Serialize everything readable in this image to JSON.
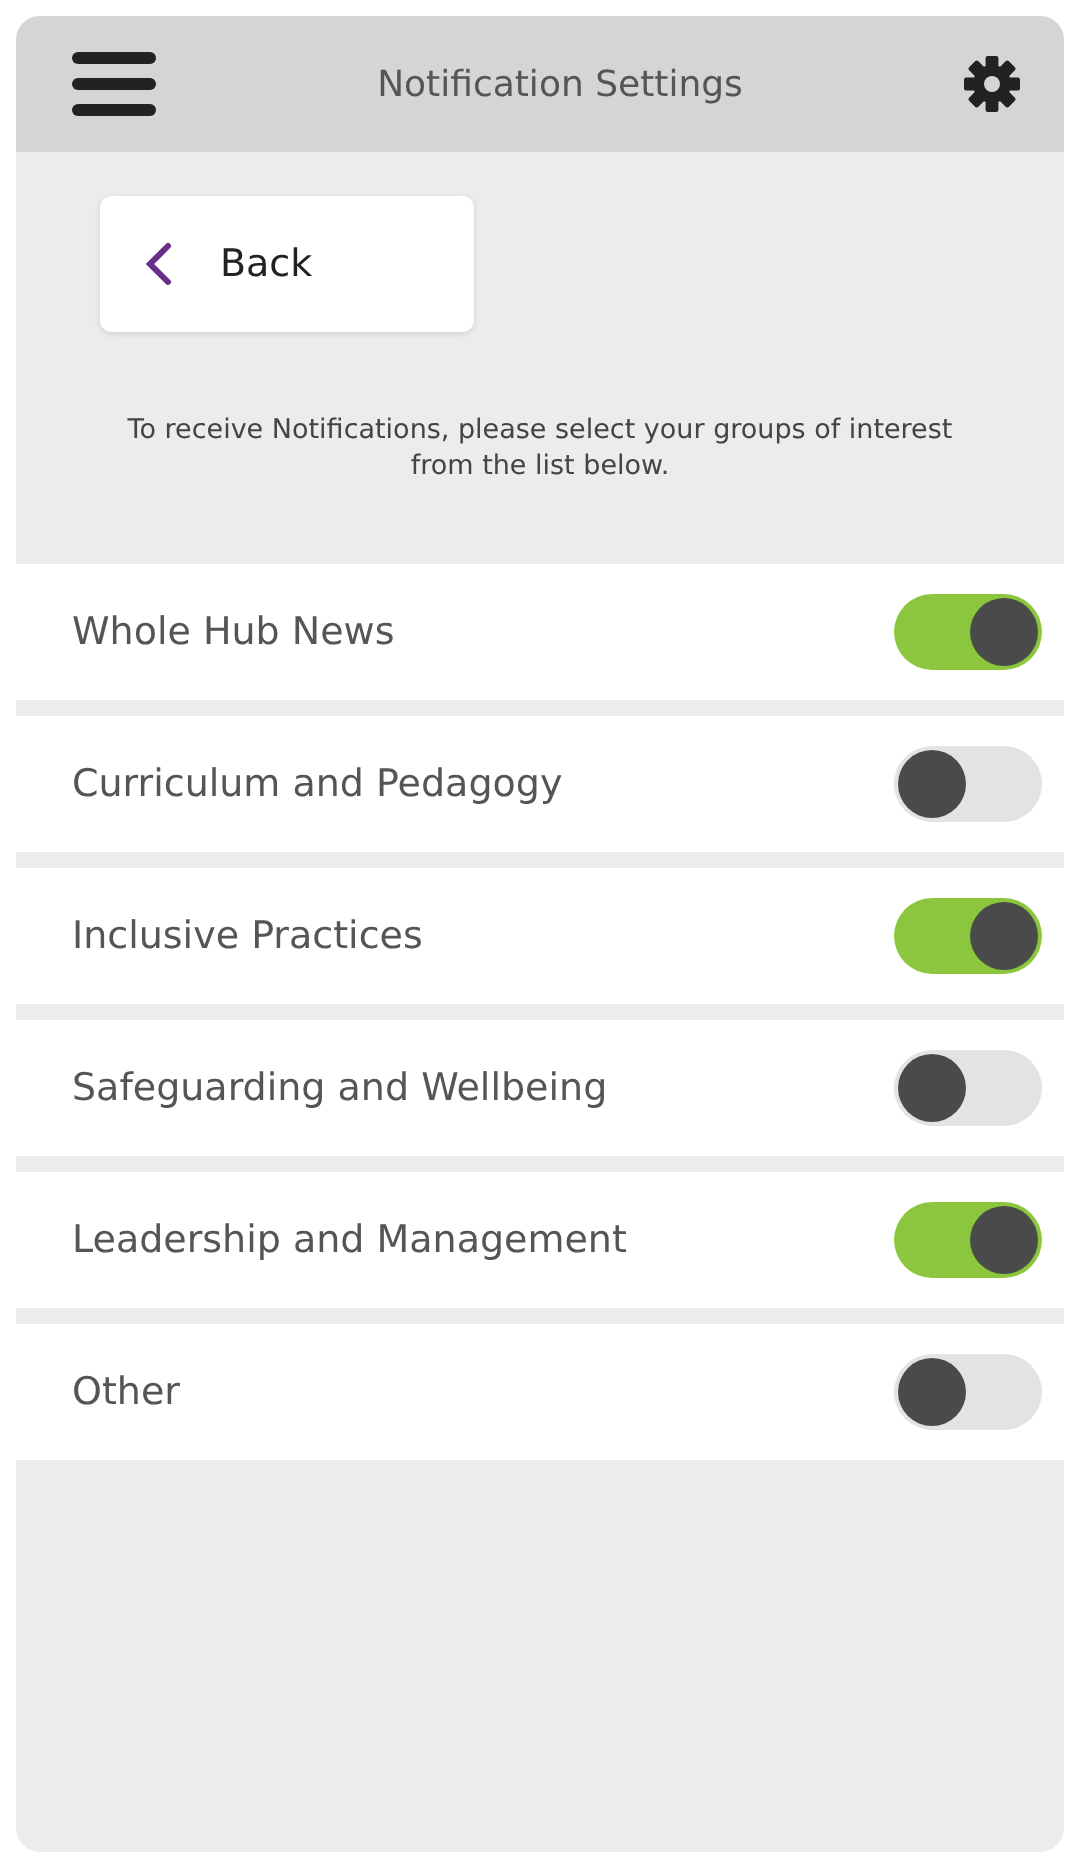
{
  "header": {
    "title": "Notification Settings"
  },
  "back": {
    "label": "Back"
  },
  "intro": "To receive Notifications, please select your groups of interest from the list below.",
  "groups": [
    {
      "label": "Whole Hub News",
      "on": true
    },
    {
      "label": "Curriculum and Pedagogy",
      "on": false
    },
    {
      "label": "Inclusive Practices",
      "on": true
    },
    {
      "label": "Safeguarding and Wellbeing",
      "on": false
    },
    {
      "label": "Leadership and Management",
      "on": true
    },
    {
      "label": "Other",
      "on": false
    }
  ]
}
